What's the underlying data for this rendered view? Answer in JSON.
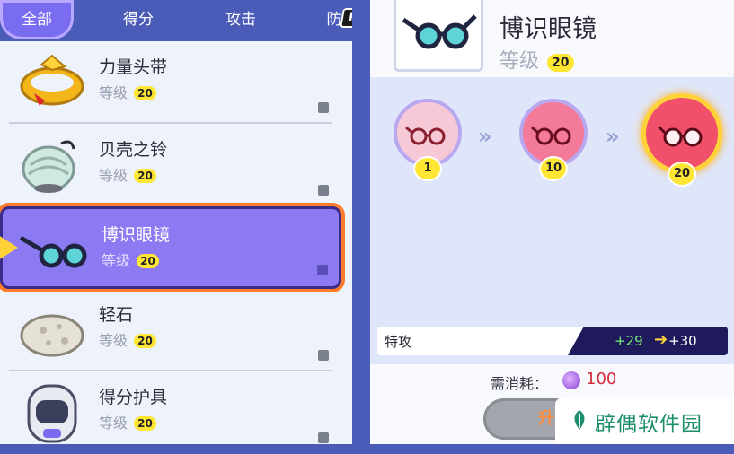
{
  "tabs": [
    {
      "label": "全部",
      "active": true
    },
    {
      "label": "得分",
      "active": false
    },
    {
      "label": "攻击",
      "active": false
    },
    {
      "label": "防",
      "active": false
    }
  ],
  "tab_badge": "R",
  "level_label": "等级",
  "items": [
    {
      "name": "力量头带",
      "level": "20",
      "icon": "headband-icon"
    },
    {
      "name": "贝壳之铃",
      "level": "20",
      "icon": "shell-bell-icon"
    },
    {
      "name": "博识眼镜",
      "level": "20",
      "icon": "wise-glasses-icon",
      "selected": true
    },
    {
      "name": "轻石",
      "level": "20",
      "icon": "float-stone-icon"
    },
    {
      "name": "得分护具",
      "level": "20",
      "icon": "score-shield-icon"
    }
  ],
  "detail": {
    "name": "博识眼镜",
    "level_label": "等级",
    "level": "20",
    "stages": [
      "1",
      "10",
      "20"
    ],
    "stat": {
      "label": "特攻",
      "from": "+29",
      "to": "+30"
    },
    "cost_label": "需消耗：",
    "cost_value": "100",
    "upgrade_label": "升"
  },
  "watermark": "辟偶软件园",
  "colors": {
    "tab_bar": "#4a5bb8",
    "selected_item": "#8b7af2",
    "selected_outline": "#ff7a2a",
    "level_badge": "#ffe534",
    "cost_value": "#d62b3a"
  }
}
